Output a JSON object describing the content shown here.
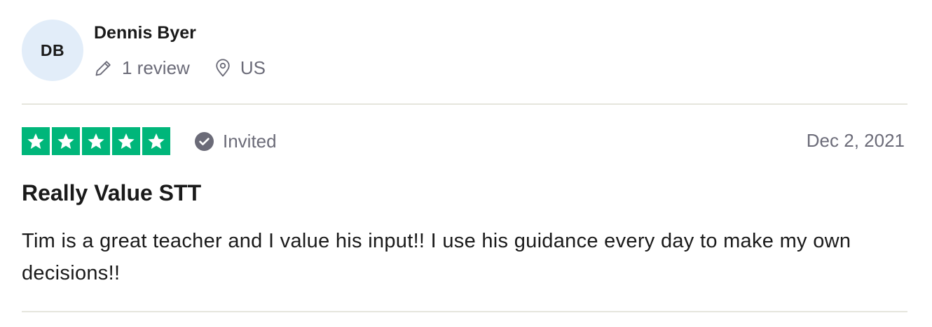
{
  "reviewer": {
    "initials": "DB",
    "name": "Dennis Byer",
    "review_count": "1 review",
    "location": "US",
    "avatar_bg": "#e2edf9"
  },
  "review": {
    "rating": 5,
    "rating_max": 5,
    "star_color": "#00b67a",
    "badge_label": "Invited",
    "date": "Dec 2, 2021",
    "title": "Really Value STT",
    "body": "Tim is a great teacher and I value his input!! I use his guidance every day to make my own decisions!!"
  },
  "icons": {
    "review_count": "pencil-icon",
    "location": "location-pin-icon",
    "invited": "check-circle-icon",
    "rating": "star-icon"
  }
}
